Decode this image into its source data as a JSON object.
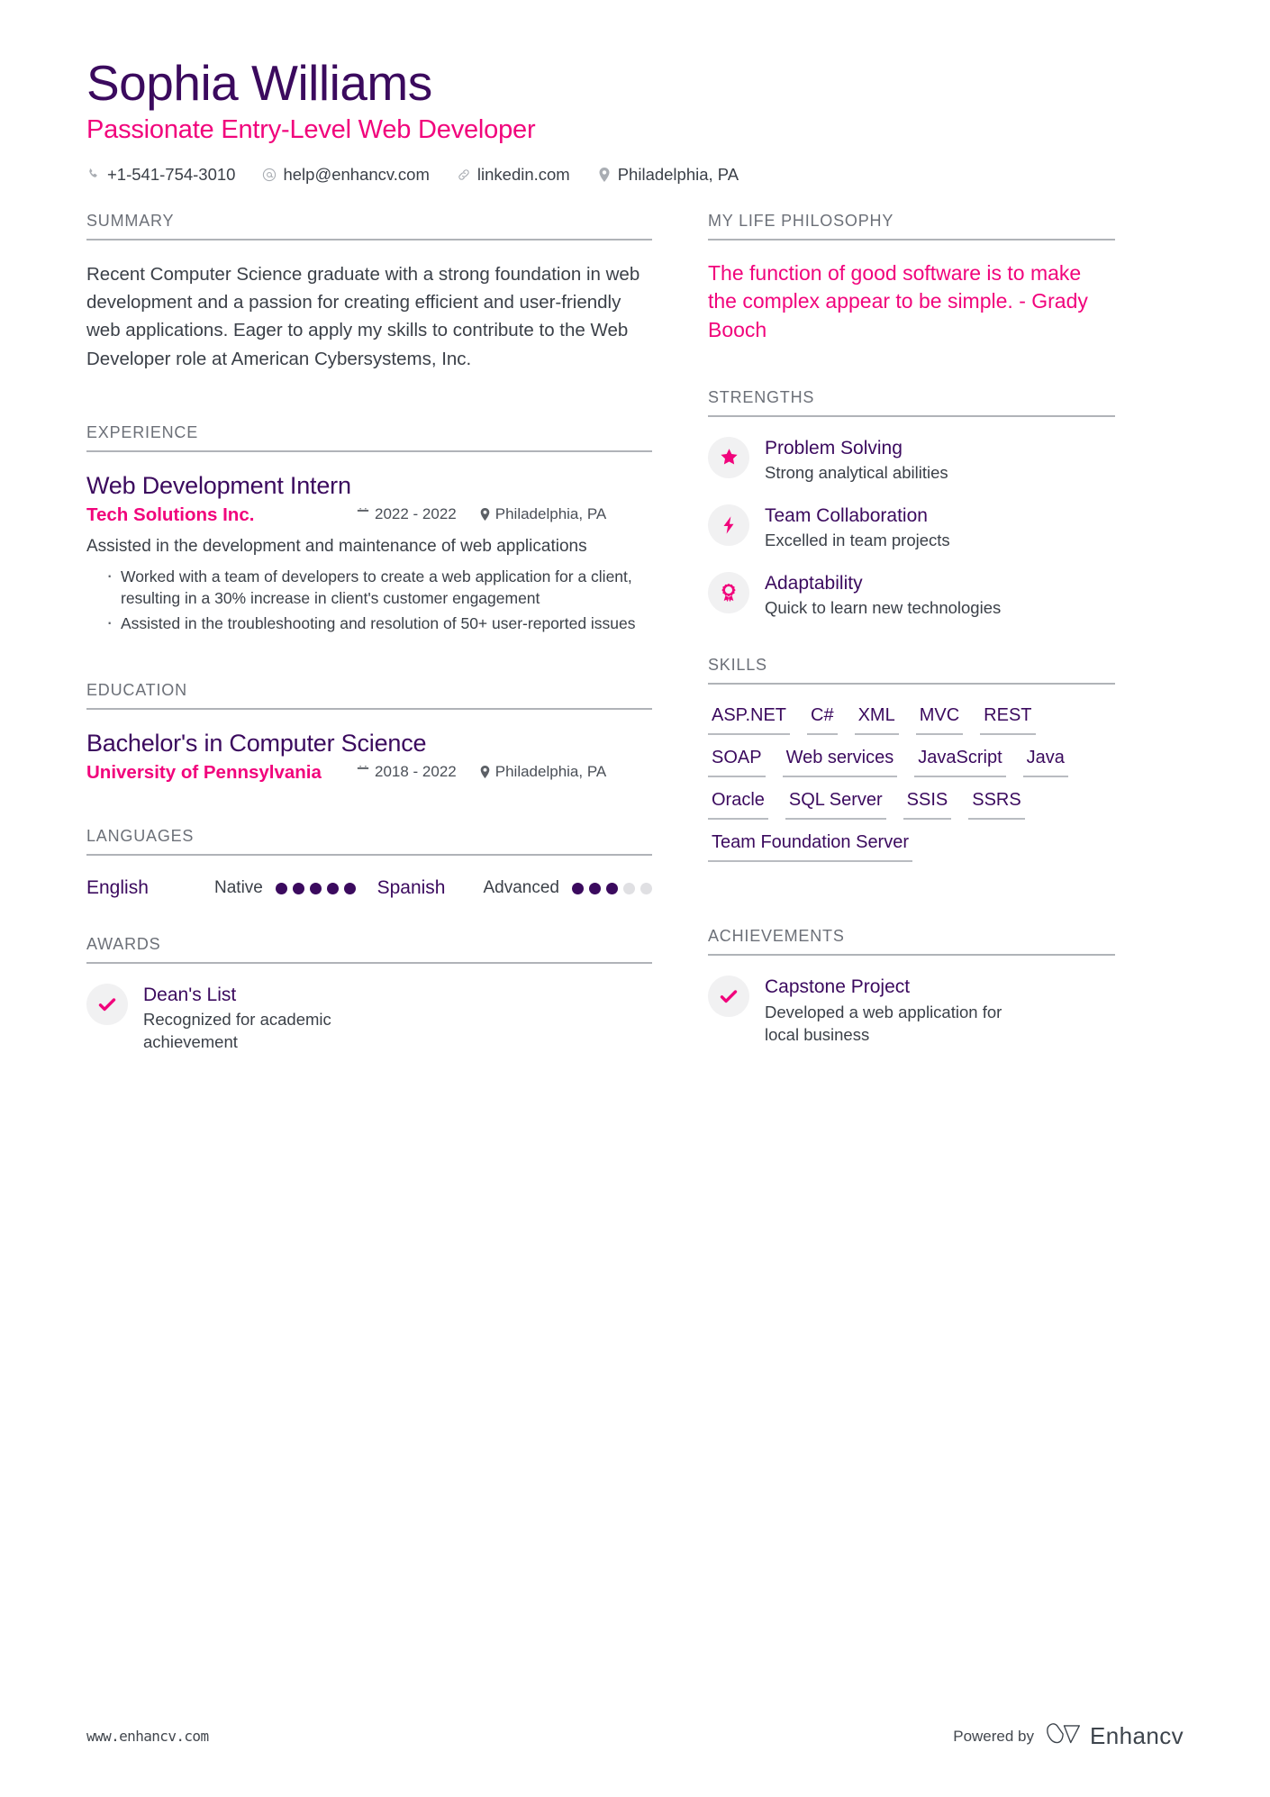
{
  "header": {
    "full_name": "Sophia Williams",
    "job_title": "Passionate Entry-Level Web Developer",
    "contacts": [
      {
        "icon": "phone-icon",
        "text": "+1-541-754-3010"
      },
      {
        "icon": "email-icon",
        "text": "help@enhancv.com"
      },
      {
        "icon": "link-icon",
        "text": "linkedin.com"
      },
      {
        "icon": "location-icon",
        "text": "Philadelphia, PA"
      }
    ]
  },
  "left": {
    "summary": {
      "title": "SUMMARY",
      "text": "Recent Computer Science graduate with a strong foundation in web development and a passion for creating efficient and user-friendly web applications. Eager to apply my skills to contribute to the Web Developer role at American Cybersystems, Inc."
    },
    "experience": {
      "title": "EXPERIENCE",
      "entries": [
        {
          "role": "Web Development Intern",
          "company": "Tech Solutions Inc.",
          "dates": "2022 - 2022",
          "location": "Philadelphia, PA",
          "description": "Assisted in the development and maintenance of web applications",
          "bullets": [
            "Worked with a team of developers to create a web application for a client, resulting in a 30% increase in client's customer engagement",
            "Assisted in the troubleshooting and resolution of 50+ user-reported issues"
          ]
        }
      ]
    },
    "education": {
      "title": "EDUCATION",
      "entries": [
        {
          "degree": "Bachelor's in Computer Science",
          "school": "University of Pennsylvania",
          "dates": "2018 - 2022",
          "location": "Philadelphia, PA"
        }
      ]
    },
    "languages": {
      "title": "LANGUAGES",
      "items": [
        {
          "name": "English",
          "level": "Native",
          "filled": 5,
          "total": 5
        },
        {
          "name": "Spanish",
          "level": "Advanced",
          "filled": 3,
          "total": 5
        }
      ]
    },
    "awards": {
      "title": "AWARDS",
      "items": [
        {
          "icon": "check-icon",
          "name": "Dean's List",
          "description": "Recognized for academic achievement"
        }
      ]
    }
  },
  "right": {
    "philosophy": {
      "title": "MY LIFE PHILOSOPHY",
      "quote": "The function of good software is to make the complex appear to be simple. - Grady Booch"
    },
    "strengths": {
      "title": "STRENGTHS",
      "items": [
        {
          "icon": "star-icon",
          "name": "Problem Solving",
          "description": "Strong analytical abilities"
        },
        {
          "icon": "bolt-icon",
          "name": "Team Collaboration",
          "description": "Excelled in team projects"
        },
        {
          "icon": "award-icon",
          "name": "Adaptability",
          "description": "Quick to learn new technologies"
        }
      ]
    },
    "skills": {
      "title": "SKILLS",
      "items": [
        "ASP.NET",
        "C#",
        "XML",
        "MVC",
        "REST",
        "SOAP",
        "Web services",
        "JavaScript",
        "Java",
        "Oracle",
        "SQL Server",
        "SSIS",
        "SSRS",
        "Team Foundation Server"
      ]
    },
    "achievements": {
      "title": "ACHIEVEMENTS",
      "items": [
        {
          "icon": "check-icon",
          "name": "Capstone Project",
          "description": "Developed a web application for local business"
        }
      ]
    }
  },
  "footer": {
    "url": "www.enhancv.com",
    "powered_by": "Powered by",
    "brand": "Enhancv"
  },
  "colors": {
    "purple": "#3B0A5E",
    "pink": "#F1047C",
    "text": "#3b4048",
    "muted": "#6c7078",
    "rule": "#b0b3b8"
  }
}
